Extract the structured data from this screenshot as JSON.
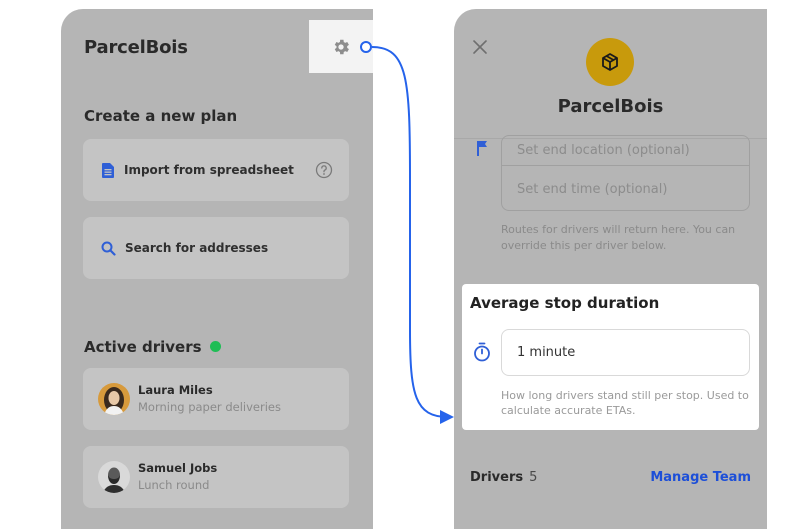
{
  "left_screen": {
    "app_title": "ParcelBois",
    "create_heading": "Create a new plan",
    "actions": [
      {
        "label": "Import from spreadsheet",
        "icon": "spreadsheet-icon"
      },
      {
        "label": "Search for addresses",
        "icon": "search-icon"
      }
    ],
    "drivers_heading": "Active drivers",
    "drivers": [
      {
        "name": "Laura Miles",
        "route": "Morning paper deliveries"
      },
      {
        "name": "Samuel Jobs",
        "route": "Lunch round"
      }
    ]
  },
  "right_screen": {
    "title": "ParcelBois",
    "end_location_placeholder": "Set end location (optional)",
    "end_time_placeholder": "Set end time (optional)",
    "return_hint": "Routes for drivers will return here. You can override this per driver below.",
    "stop_duration": {
      "title": "Average stop duration",
      "value": "1 minute",
      "hint": "How long drivers stand still per stop. Used to calculate accurate ETAs."
    },
    "drivers_label": "Drivers",
    "drivers_count": "5",
    "manage_link": "Manage Team"
  },
  "colors": {
    "accent_blue": "#1d4fd8",
    "connector_blue": "#2563eb",
    "status_green": "#1fbd55",
    "logo_gold": "#c89a0c"
  }
}
